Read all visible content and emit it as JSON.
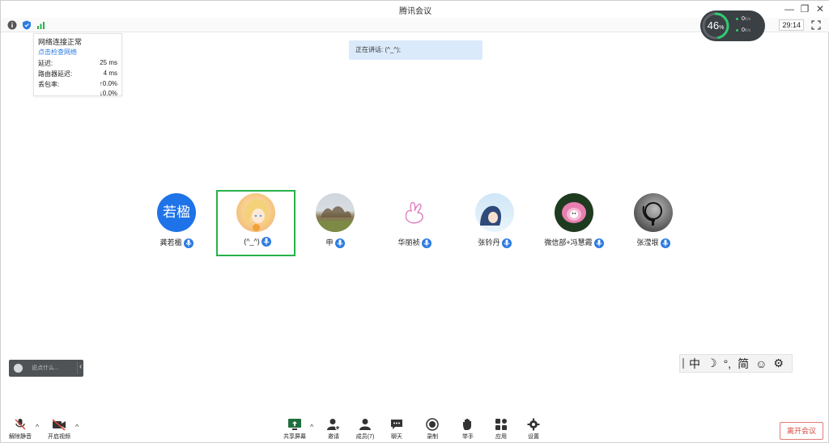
{
  "app": {
    "title": "腾讯会议"
  },
  "header": {
    "timer": "29:14"
  },
  "network_popover": {
    "title": "网络连接正常",
    "link": "点击检查网络",
    "rows": [
      {
        "label": "延迟:",
        "value": "25 ms"
      },
      {
        "label": "路由器延迟:",
        "value": "4 ms"
      },
      {
        "label": "丢包率:",
        "value": "↑0.0%"
      },
      {
        "label": "",
        "value": "↓0.0%"
      }
    ]
  },
  "speaking": {
    "text": "正在讲话: (^_^);"
  },
  "cpu_widget": {
    "percent": "46",
    "percent_sign": "%",
    "upload": "0",
    "download": "0",
    "unit": "K/s",
    "upload_color": "#2ecc71",
    "download_color": "#2ecc71"
  },
  "participants": [
    {
      "name": "龚若楹",
      "avatar_text": "若楹",
      "active": false
    },
    {
      "name": "(^_^)",
      "avatar_text": "",
      "active": true
    },
    {
      "name": "申",
      "avatar_text": "",
      "active": false
    },
    {
      "name": "华丽祯",
      "avatar_text": "",
      "active": false
    },
    {
      "name": "张钤丹",
      "avatar_text": "",
      "active": false
    },
    {
      "name": "微信部+冯慧霞",
      "avatar_text": "",
      "active": false
    },
    {
      "name": "张滢垠",
      "avatar_text": "",
      "active": false
    }
  ],
  "chat": {
    "placeholder": "说点什么...",
    "toggle": "‹"
  },
  "ime": {
    "items": [
      "中",
      "☽",
      "°,",
      "简",
      "☺",
      "⚙"
    ]
  },
  "toolbar": {
    "unmute": "解除静音",
    "start_video": "开启视频",
    "share_screen": "共享屏幕",
    "invite": "邀请",
    "members": "成员(7)",
    "chat": "聊天",
    "record": "录制",
    "raise_hand": "举手",
    "apps": "应用",
    "settings": "设置",
    "leave": "离开会议"
  },
  "colors": {
    "accent": "#2a7ae2",
    "active_border": "#27b24a",
    "leave": "#d64a3e"
  }
}
